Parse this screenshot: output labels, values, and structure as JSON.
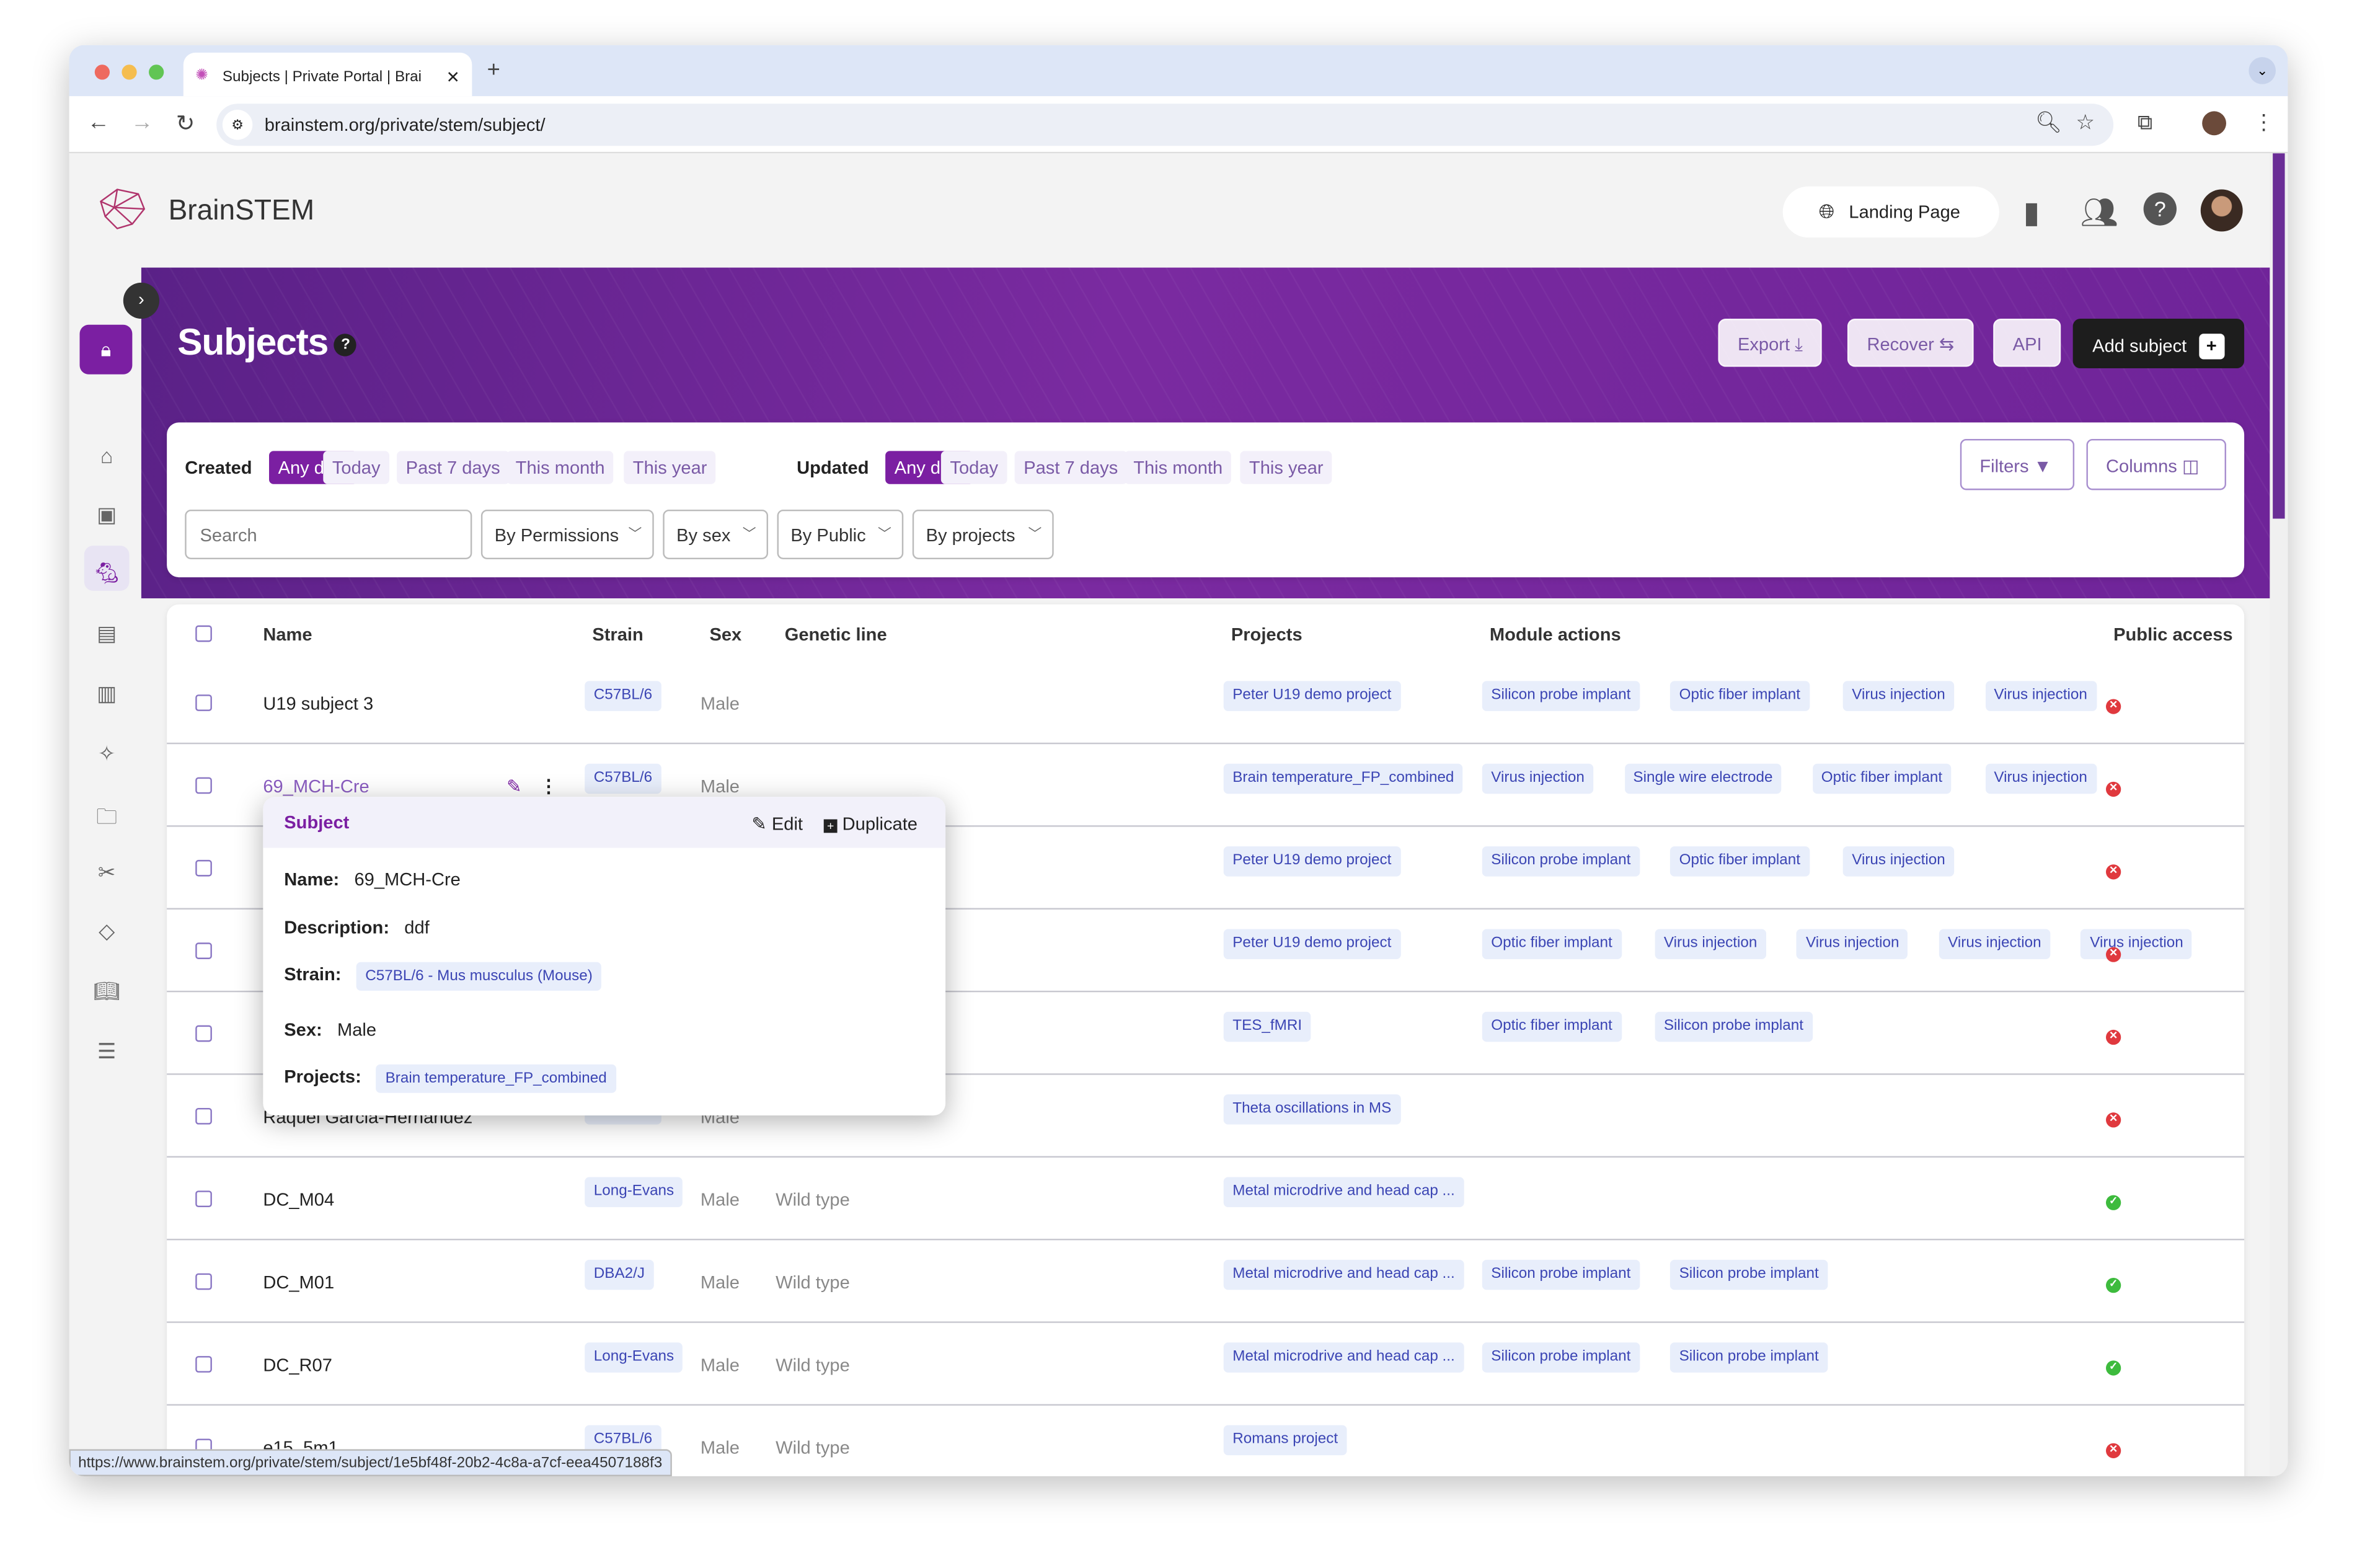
{
  "browser": {
    "tab_title": "Subjects | Private Portal | Brai",
    "url": "brainstem.org/private/stem/subject/",
    "status_url": "https://www.brainstem.org/private/stem/subject/1e5bf48f-20b2-4c8a-a7cf-eea4507188f3"
  },
  "header": {
    "brand": "BrainSTEM",
    "landing": "Landing Page"
  },
  "page": {
    "title": "Subjects",
    "help": "?",
    "export": "Export",
    "recover": "Recover",
    "api": "API",
    "add": "Add subject",
    "add_icon": "+"
  },
  "filters": {
    "created_label": "Created",
    "updated_label": "Updated",
    "created": [
      "Any date",
      "Today",
      "Past 7 days",
      "This month",
      "This year"
    ],
    "updated": [
      "Any date",
      "Today",
      "Past 7 days",
      "This month",
      "This year"
    ],
    "active_created": "Any date",
    "active_updated": "Any date",
    "search_placeholder": "Search",
    "dropdowns": [
      "By Permissions",
      "By sex",
      "By Public",
      "By projects"
    ],
    "filters_btn": "Filters",
    "columns_btn": "Columns"
  },
  "table": {
    "headers": {
      "name": "Name",
      "strain": "Strain",
      "sex": "Sex",
      "genetic": "Genetic line",
      "projects": "Projects",
      "modules": "Module actions",
      "public": "Public access"
    },
    "rows": [
      {
        "name": "U19 subject 3",
        "strain": "C57BL/6",
        "sex": "Male",
        "genetic": "",
        "projects": [
          "Peter U19 demo project"
        ],
        "modules": [
          "Silicon probe implant",
          "Optic fiber implant",
          "Virus injection",
          "Virus injection"
        ],
        "public": false
      },
      {
        "name": "69_MCH-Cre",
        "strain": "C57BL/6",
        "sex": "Male",
        "genetic": "",
        "projects": [
          "Brain temperature_FP_combined"
        ],
        "modules": [
          "Virus injection",
          "Single wire electrode",
          "Optic fiber implant",
          "Virus injection"
        ],
        "public": false,
        "hovered": true
      },
      {
        "name": "",
        "strain": "",
        "sex": "",
        "genetic": "",
        "projects": [
          "Peter U19 demo project"
        ],
        "modules": [
          "Silicon probe implant",
          "Optic fiber implant",
          "Virus injection"
        ],
        "public": false
      },
      {
        "name": "",
        "strain": "",
        "sex": "",
        "genetic": "",
        "projects": [
          "Peter U19 demo project"
        ],
        "modules": [
          "Optic fiber implant",
          "Virus injection",
          "Virus injection",
          "Virus injection",
          "Virus injection"
        ],
        "public": false
      },
      {
        "name": "",
        "strain": "",
        "sex": "",
        "genetic": "",
        "projects": [
          "TES_fMRI"
        ],
        "modules": [
          "Optic fiber implant",
          "Silicon probe implant"
        ],
        "public": false
      },
      {
        "name": "Raquel Garcia-Hernandez",
        "strain": "C57BL/6",
        "sex": "Male",
        "genetic": "",
        "projects": [
          "Theta oscillations in MS"
        ],
        "modules": [],
        "public": false
      },
      {
        "name": "DC_M04",
        "strain": "Long-Evans",
        "sex": "Male",
        "genetic": "Wild type",
        "projects": [
          "Metal microdrive and head cap ..."
        ],
        "modules": [],
        "public": true
      },
      {
        "name": "DC_M01",
        "strain": "DBA2/J",
        "sex": "Male",
        "genetic": "Wild type",
        "projects": [
          "Metal microdrive and head cap ..."
        ],
        "modules": [
          "Silicon probe implant",
          "Silicon probe implant"
        ],
        "public": true
      },
      {
        "name": "DC_R07",
        "strain": "Long-Evans",
        "sex": "Male",
        "genetic": "Wild type",
        "projects": [
          "Metal microdrive and head cap ..."
        ],
        "modules": [
          "Silicon probe implant",
          "Silicon probe implant"
        ],
        "public": true
      },
      {
        "name": "e15_5m1",
        "strain": "C57BL/6",
        "sex": "Male",
        "genetic": "Wild type",
        "projects": [
          "Romans project"
        ],
        "modules": [],
        "public": false
      }
    ]
  },
  "popover": {
    "title": "Subject",
    "edit": "Edit",
    "duplicate": "Duplicate",
    "name_label": "Name:",
    "name": "69_MCH-Cre",
    "desc_label": "Description:",
    "desc": "ddf",
    "strain_label": "Strain:",
    "strain": "C57BL/6 - Mus musculus (Mouse)",
    "sex_label": "Sex:",
    "sex": "Male",
    "projects_label": "Projects:",
    "projects": "Brain temperature_FP_combined"
  },
  "colors": {
    "brand": "#7b1fa2",
    "pill_bg": "#e8eefb",
    "pill_text": "#3b45b4",
    "public_yes": "#3dbb3d",
    "public_no": "#e0393e"
  }
}
